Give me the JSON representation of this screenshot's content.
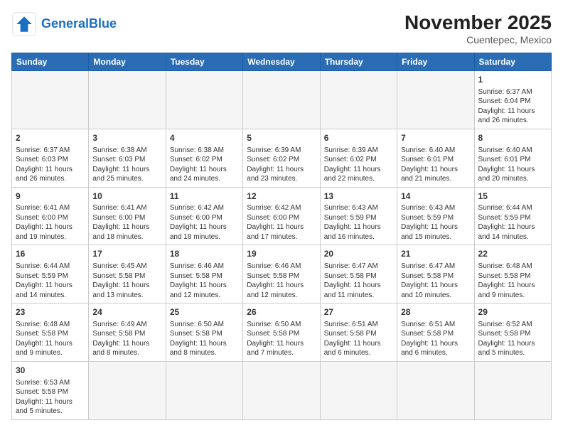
{
  "header": {
    "logo_general": "General",
    "logo_blue": "Blue",
    "month_year": "November 2025",
    "location": "Cuentepec, Mexico"
  },
  "weekdays": [
    "Sunday",
    "Monday",
    "Tuesday",
    "Wednesday",
    "Thursday",
    "Friday",
    "Saturday"
  ],
  "weeks": [
    [
      {
        "day": "",
        "info": ""
      },
      {
        "day": "",
        "info": ""
      },
      {
        "day": "",
        "info": ""
      },
      {
        "day": "",
        "info": ""
      },
      {
        "day": "",
        "info": ""
      },
      {
        "day": "",
        "info": ""
      },
      {
        "day": "1",
        "info": "Sunrise: 6:37 AM\nSunset: 6:04 PM\nDaylight: 11 hours\nand 26 minutes."
      }
    ],
    [
      {
        "day": "2",
        "info": "Sunrise: 6:37 AM\nSunset: 6:03 PM\nDaylight: 11 hours\nand 26 minutes."
      },
      {
        "day": "3",
        "info": "Sunrise: 6:38 AM\nSunset: 6:03 PM\nDaylight: 11 hours\nand 25 minutes."
      },
      {
        "day": "4",
        "info": "Sunrise: 6:38 AM\nSunset: 6:02 PM\nDaylight: 11 hours\nand 24 minutes."
      },
      {
        "day": "5",
        "info": "Sunrise: 6:39 AM\nSunset: 6:02 PM\nDaylight: 11 hours\nand 23 minutes."
      },
      {
        "day": "6",
        "info": "Sunrise: 6:39 AM\nSunset: 6:02 PM\nDaylight: 11 hours\nand 22 minutes."
      },
      {
        "day": "7",
        "info": "Sunrise: 6:40 AM\nSunset: 6:01 PM\nDaylight: 11 hours\nand 21 minutes."
      },
      {
        "day": "8",
        "info": "Sunrise: 6:40 AM\nSunset: 6:01 PM\nDaylight: 11 hours\nand 20 minutes."
      }
    ],
    [
      {
        "day": "9",
        "info": "Sunrise: 6:41 AM\nSunset: 6:00 PM\nDaylight: 11 hours\nand 19 minutes."
      },
      {
        "day": "10",
        "info": "Sunrise: 6:41 AM\nSunset: 6:00 PM\nDaylight: 11 hours\nand 18 minutes."
      },
      {
        "day": "11",
        "info": "Sunrise: 6:42 AM\nSunset: 6:00 PM\nDaylight: 11 hours\nand 18 minutes."
      },
      {
        "day": "12",
        "info": "Sunrise: 6:42 AM\nSunset: 6:00 PM\nDaylight: 11 hours\nand 17 minutes."
      },
      {
        "day": "13",
        "info": "Sunrise: 6:43 AM\nSunset: 5:59 PM\nDaylight: 11 hours\nand 16 minutes."
      },
      {
        "day": "14",
        "info": "Sunrise: 6:43 AM\nSunset: 5:59 PM\nDaylight: 11 hours\nand 15 minutes."
      },
      {
        "day": "15",
        "info": "Sunrise: 6:44 AM\nSunset: 5:59 PM\nDaylight: 11 hours\nand 14 minutes."
      }
    ],
    [
      {
        "day": "16",
        "info": "Sunrise: 6:44 AM\nSunset: 5:59 PM\nDaylight: 11 hours\nand 14 minutes."
      },
      {
        "day": "17",
        "info": "Sunrise: 6:45 AM\nSunset: 5:58 PM\nDaylight: 11 hours\nand 13 minutes."
      },
      {
        "day": "18",
        "info": "Sunrise: 6:46 AM\nSunset: 5:58 PM\nDaylight: 11 hours\nand 12 minutes."
      },
      {
        "day": "19",
        "info": "Sunrise: 6:46 AM\nSunset: 5:58 PM\nDaylight: 11 hours\nand 12 minutes."
      },
      {
        "day": "20",
        "info": "Sunrise: 6:47 AM\nSunset: 5:58 PM\nDaylight: 11 hours\nand 11 minutes."
      },
      {
        "day": "21",
        "info": "Sunrise: 6:47 AM\nSunset: 5:58 PM\nDaylight: 11 hours\nand 10 minutes."
      },
      {
        "day": "22",
        "info": "Sunrise: 6:48 AM\nSunset: 5:58 PM\nDaylight: 11 hours\nand 9 minutes."
      }
    ],
    [
      {
        "day": "23",
        "info": "Sunrise: 6:48 AM\nSunset: 5:58 PM\nDaylight: 11 hours\nand 9 minutes."
      },
      {
        "day": "24",
        "info": "Sunrise: 6:49 AM\nSunset: 5:58 PM\nDaylight: 11 hours\nand 8 minutes."
      },
      {
        "day": "25",
        "info": "Sunrise: 6:50 AM\nSunset: 5:58 PM\nDaylight: 11 hours\nand 8 minutes."
      },
      {
        "day": "26",
        "info": "Sunrise: 6:50 AM\nSunset: 5:58 PM\nDaylight: 11 hours\nand 7 minutes."
      },
      {
        "day": "27",
        "info": "Sunrise: 6:51 AM\nSunset: 5:58 PM\nDaylight: 11 hours\nand 6 minutes."
      },
      {
        "day": "28",
        "info": "Sunrise: 6:51 AM\nSunset: 5:58 PM\nDaylight: 11 hours\nand 6 minutes."
      },
      {
        "day": "29",
        "info": "Sunrise: 6:52 AM\nSunset: 5:58 PM\nDaylight: 11 hours\nand 5 minutes."
      }
    ],
    [
      {
        "day": "30",
        "info": "Sunrise: 6:53 AM\nSunset: 5:58 PM\nDaylight: 11 hours\nand 5 minutes."
      },
      {
        "day": "",
        "info": ""
      },
      {
        "day": "",
        "info": ""
      },
      {
        "day": "",
        "info": ""
      },
      {
        "day": "",
        "info": ""
      },
      {
        "day": "",
        "info": ""
      },
      {
        "day": "",
        "info": ""
      }
    ]
  ]
}
